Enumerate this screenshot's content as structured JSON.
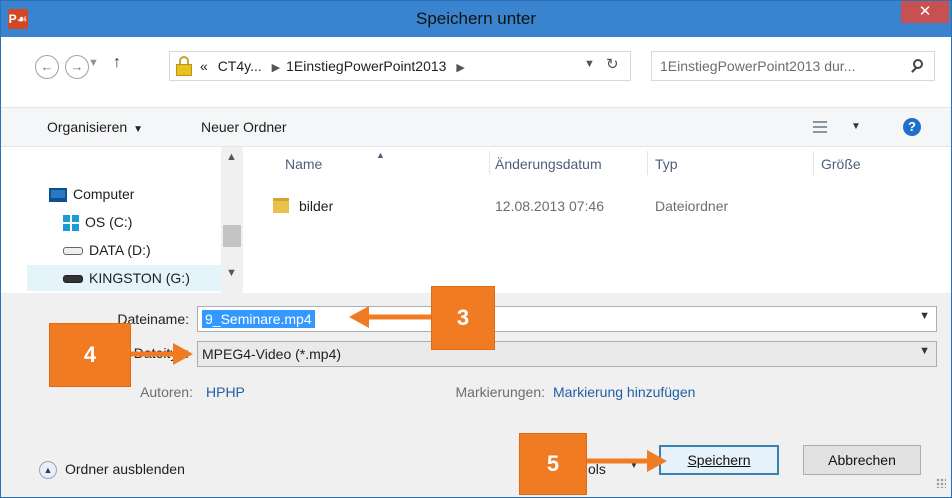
{
  "window": {
    "title": "Speichern unter",
    "app_icon_text": "P☙",
    "close_glyph": "✕"
  },
  "nav": {
    "back_glyph": "←",
    "forward_glyph": "→",
    "up_glyph": "↑",
    "breadcrumb": [
      "«",
      "CT4y...",
      "1EinstiegPowerPoint2013"
    ],
    "search_placeholder": "1EinstiegPowerPoint2013 dur..."
  },
  "toolbar": {
    "organize_label": "Organisieren",
    "new_folder_label": "Neuer Ordner",
    "help_glyph": "?"
  },
  "tree": {
    "items": [
      {
        "label": "Computer",
        "icon": "computer-icon"
      },
      {
        "label": "OS (C:)",
        "icon": "windows-drive-icon"
      },
      {
        "label": "DATA (D:)",
        "icon": "drive-icon"
      },
      {
        "label": "KINGSTON (G:)",
        "icon": "usb-drive-icon"
      }
    ]
  },
  "files": {
    "columns": [
      "Name",
      "Änderungsdatum",
      "Typ",
      "Größe"
    ],
    "rows": [
      {
        "name": "bilder",
        "date": "12.08.2013 07:46",
        "type": "Dateiordner",
        "size": ""
      }
    ]
  },
  "form": {
    "filename_label": "Dateiname:",
    "filename_value": "9_Seminare.mp4",
    "filetype_label": "Dateityp:",
    "filetype_value": "MPEG4-Video (*.mp4)",
    "authors_label": "Autoren:",
    "authors_value": "HPHP",
    "tags_label": "Markierungen:",
    "tags_value": "Markierung hinzufügen"
  },
  "footer": {
    "hide_folders_label": "Ordner ausblenden",
    "tools_partial": "ols",
    "save_label": "Speichern",
    "cancel_label": "Abbrechen"
  },
  "annotations": {
    "badges": [
      "3",
      "4",
      "5"
    ],
    "color": "#f17b22"
  }
}
